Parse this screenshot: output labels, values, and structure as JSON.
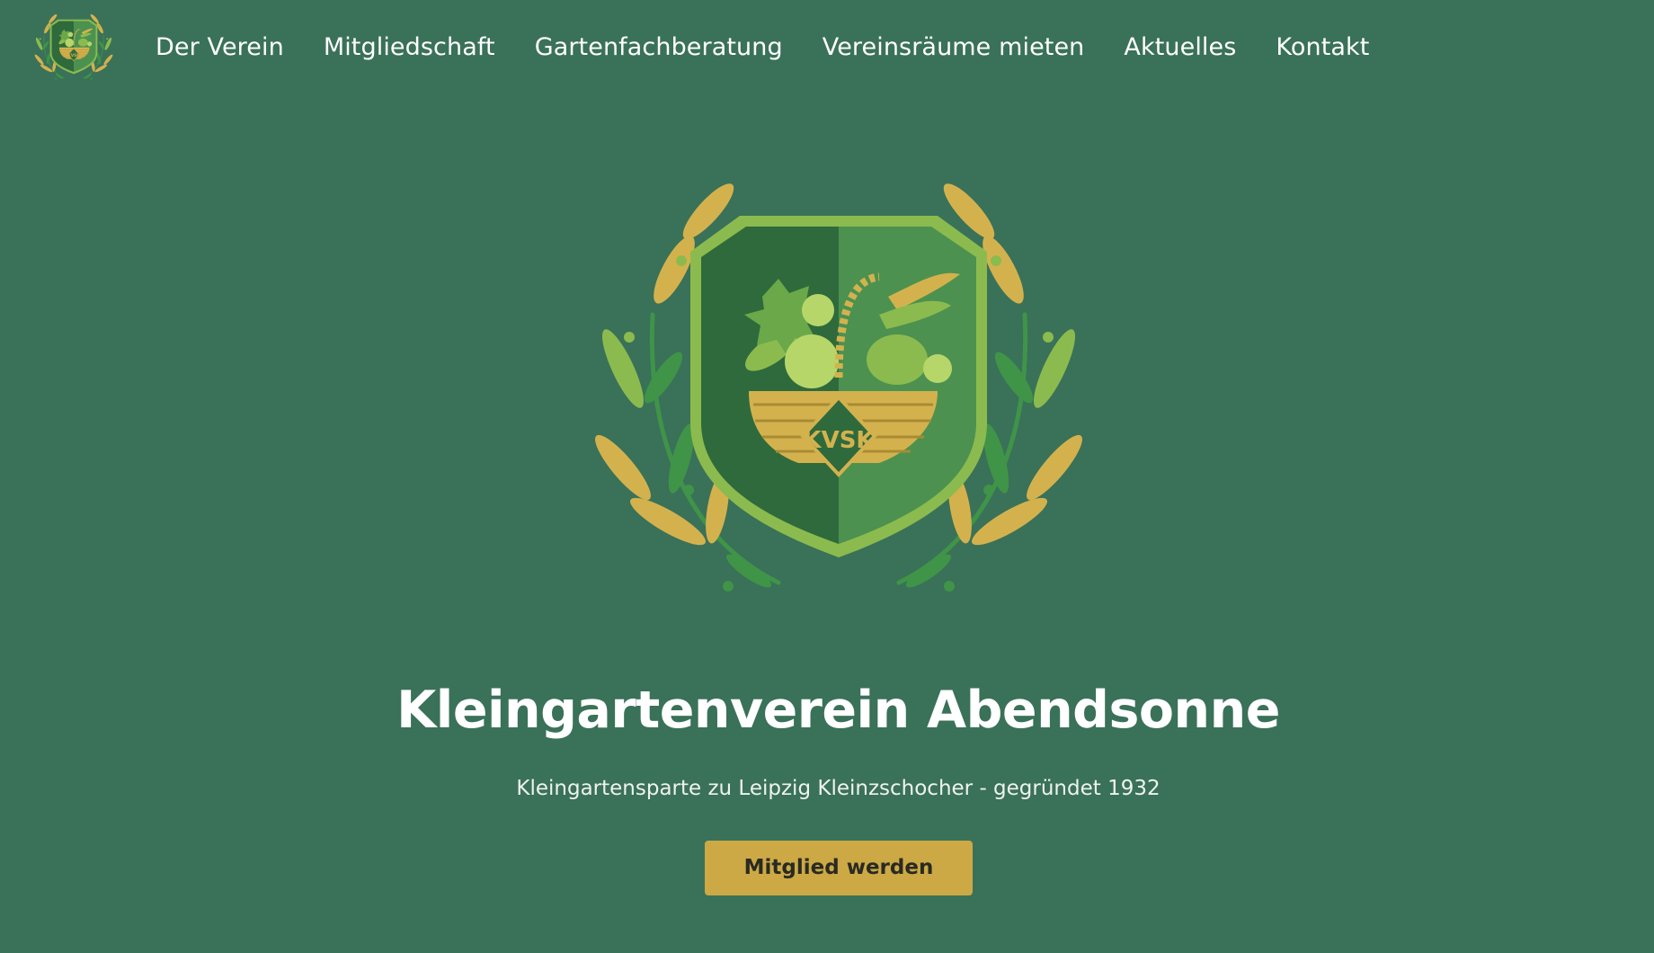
{
  "nav": {
    "logo_icon": "club-crest-icon",
    "items": [
      {
        "label": "Der Verein"
      },
      {
        "label": "Mitgliedschaft"
      },
      {
        "label": "Gartenfachberatung"
      },
      {
        "label": "Vereinsräume mieten"
      },
      {
        "label": "Aktuelles"
      },
      {
        "label": "Kontakt"
      }
    ]
  },
  "hero": {
    "emblem_icon": "club-crest-icon",
    "emblem_monogram": "KVSK",
    "title": "Kleingartenverein Abendsonne",
    "subtitle": "Kleingartensparte zu Leipzig Kleinzschocher - gegründet 1932",
    "cta_label": "Mitglied werden"
  },
  "colors": {
    "background": "#3a7159",
    "gold": "#cca945",
    "shield_dark": "#2f6a3c",
    "shield_light": "#4c9150",
    "leaf_green": "#8bbb4e"
  }
}
